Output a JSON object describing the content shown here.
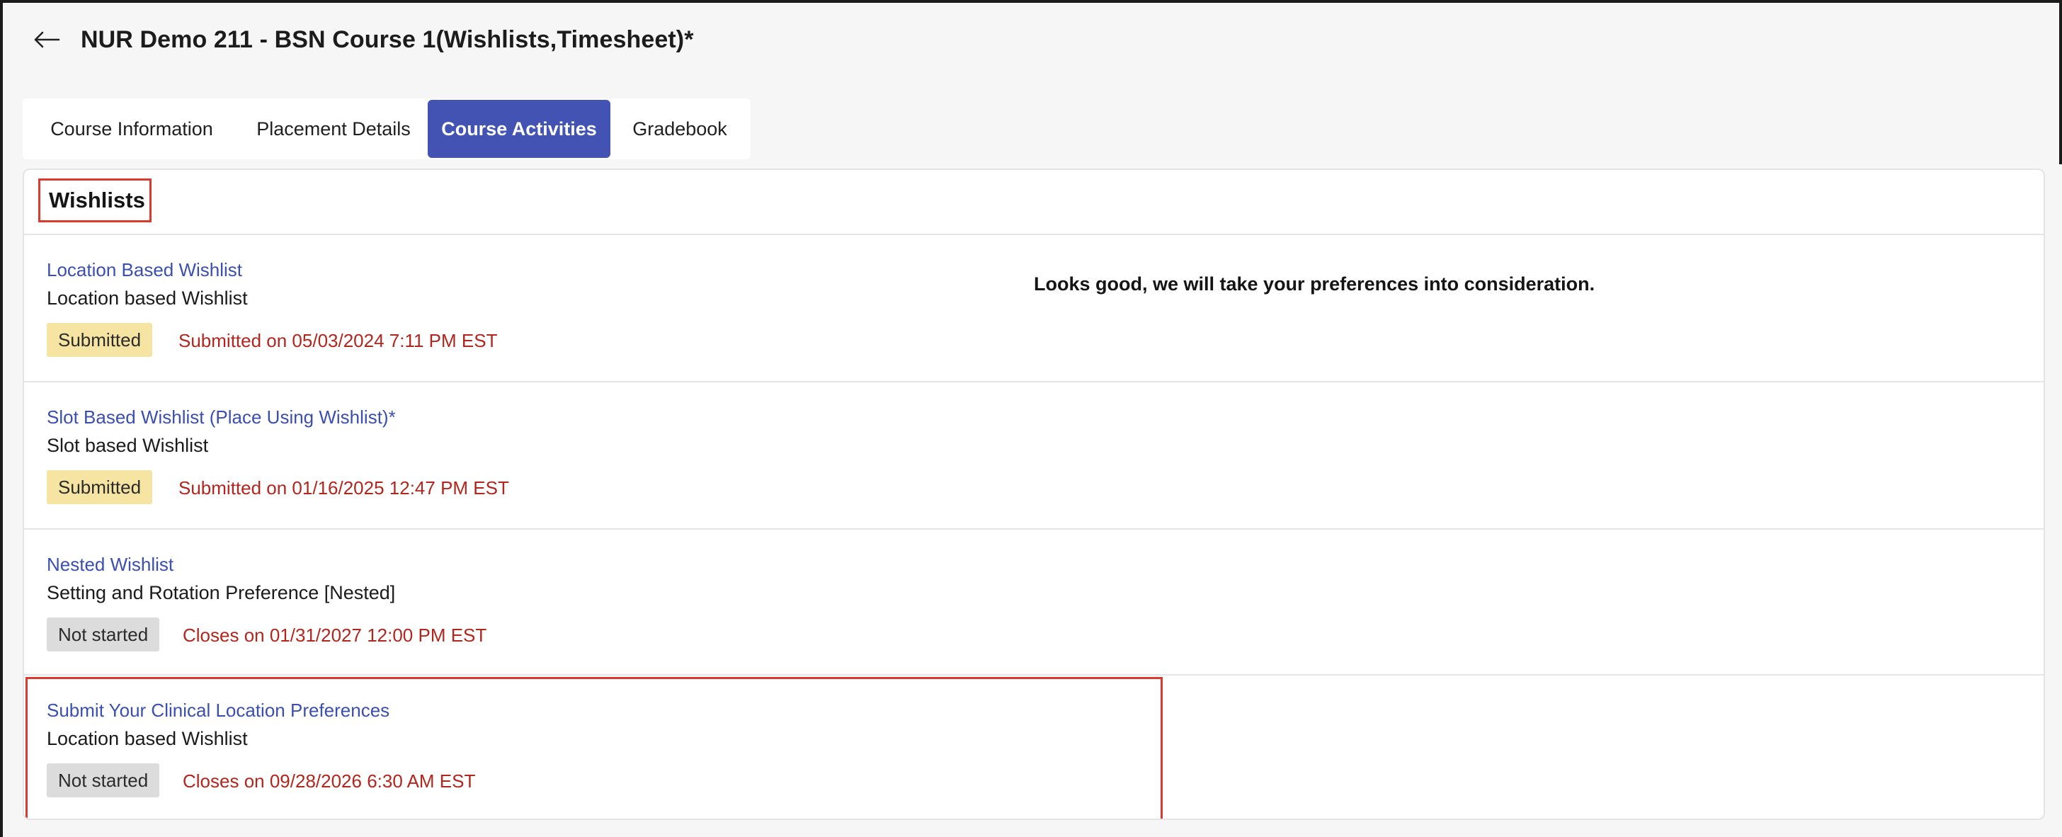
{
  "header": {
    "title": "NUR Demo 211 - BSN Course 1(Wishlists,Timesheet)*",
    "back_icon": "arrow-left-icon"
  },
  "tabs": [
    {
      "label": "Course Information",
      "active": false
    },
    {
      "label": "Placement Details",
      "active": false
    },
    {
      "label": "Course Activities",
      "active": true
    },
    {
      "label": "Gradebook",
      "active": false
    }
  ],
  "section": {
    "title": "Wishlists"
  },
  "wishlists": [
    {
      "name": "Location Based Wishlist",
      "type": "Location based Wishlist",
      "status": "Submitted",
      "status_detail": "Submitted on 05/03/2024 7:11 PM EST",
      "feedback": "Looks good, we will take your preferences into consideration."
    },
    {
      "name": "Slot Based Wishlist (Place Using Wishlist)*",
      "type": "Slot based Wishlist",
      "status": "Submitted",
      "status_detail": "Submitted on 01/16/2025 12:47 PM EST",
      "feedback": ""
    },
    {
      "name": "Nested Wishlist",
      "type": "Setting and Rotation Preference [Nested]",
      "status": "Not started",
      "status_detail": "Closes on 01/31/2027 12:00 PM EST",
      "feedback": ""
    },
    {
      "name": "Submit Your Clinical Location Preferences",
      "type": "Location based Wishlist",
      "status": "Not started",
      "status_detail": "Closes on 09/28/2026 6:30 AM EST",
      "feedback": ""
    }
  ],
  "colors": {
    "accent": "#4353b3",
    "link": "#3b4fb0",
    "status_red": "#b3261e",
    "badge_submitted": "#f5e4a2",
    "badge_not_started": "#dcdcdc",
    "highlight": "#d93b30"
  }
}
